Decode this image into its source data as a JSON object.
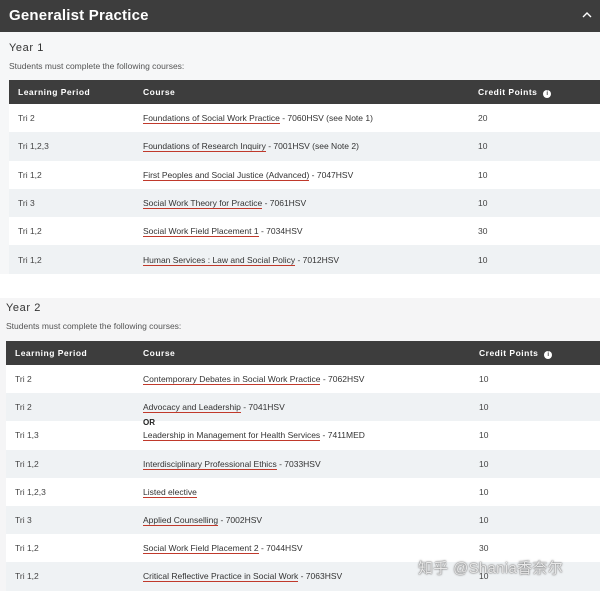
{
  "page": {
    "title": "Generalist Practice"
  },
  "year1": {
    "title": "Year 1",
    "intro": "Students must complete the following courses:",
    "headers": {
      "period": "Learning Period",
      "course": "Course",
      "points": "Credit Points",
      "info": "i"
    },
    "rows": [
      {
        "period": "Tri 2",
        "course_name": "Foundations of Social Work Practice",
        "course_rest": " - 7060HSV (see Note 1)",
        "points": "20"
      },
      {
        "period": "Tri 1,2,3",
        "course_name": "Foundations of Research Inquiry",
        "course_rest": " - 7001HSV (see Note 2)",
        "points": "10"
      },
      {
        "period": "Tri 1,2",
        "course_name": "First Peoples and Social Justice (Advanced)",
        "course_rest": " - 7047HSV",
        "points": "10"
      },
      {
        "period": "Tri 3",
        "course_name": "Social Work Theory for Practice",
        "course_rest": " - 7061HSV",
        "points": "10"
      },
      {
        "period": "Tri 1,2",
        "course_name": "Social Work Field Placement 1",
        "course_rest": " - 7034HSV",
        "points": "30"
      },
      {
        "period": "Tri 1,2",
        "course_name": "Human Services : Law and Social Policy",
        "course_rest": " - 7012HSV",
        "points": "10"
      }
    ]
  },
  "year2": {
    "title": "Year 2",
    "intro": "Students must complete the following courses:",
    "headers": {
      "period": "Learning Period",
      "course": "Course",
      "points": "Credit Points",
      "info": "i"
    },
    "or_label": "OR",
    "rows": [
      {
        "period": "Tri 2",
        "course_name": "Contemporary Debates in Social Work Practice",
        "course_rest": " - 7062HSV",
        "points": "10"
      },
      {
        "period": "Tri 2",
        "course_name": "Advocacy and Leadership",
        "course_rest": " - 7041HSV",
        "points": "10"
      },
      {
        "period": "Tri 1,3",
        "course_name": "Leadership in Management for Health Services",
        "course_rest": " - 7411MED",
        "points": "10"
      },
      {
        "period": "Tri 1,2",
        "course_name": "Interdisciplinary Professional Ethics",
        "course_rest": " - 7033HSV",
        "points": "10"
      },
      {
        "period": "Tri 1,2,3",
        "course_name": "Listed elective",
        "course_rest": "",
        "points": "10"
      },
      {
        "period": "Tri 3",
        "course_name": "Applied Counselling",
        "course_rest": " - 7002HSV",
        "points": "10"
      },
      {
        "period": "Tri 1,2",
        "course_name": "Social Work Field Placement 2",
        "course_rest": " - 7044HSV",
        "points": "30"
      },
      {
        "period": "Tri 1,2",
        "course_name": "Critical Reflective Practice in Social Work",
        "course_rest": " - 7063HSV",
        "points": "10"
      }
    ]
  },
  "watermark": "知乎 @Shania香奈尔",
  "colors": {
    "header_bg": "#3d3d3d",
    "row_alt": "#eff2f4",
    "link_underline": "#c0392b"
  }
}
